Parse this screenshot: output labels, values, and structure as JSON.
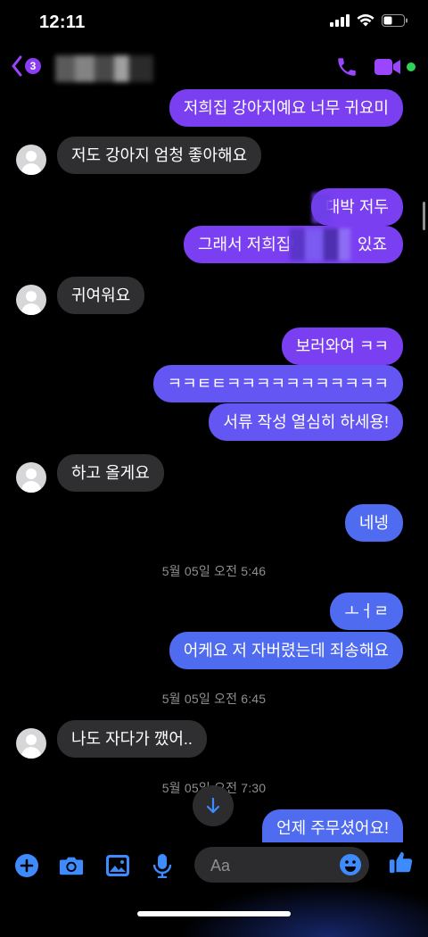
{
  "status_bar": {
    "time": "12:11"
  },
  "header": {
    "unread_count": "3"
  },
  "colors": {
    "purple": "#7b3ff2",
    "blue": "#4f6bf0",
    "incoming": "#2f2f31",
    "accent": "#9b45ff",
    "online": "#31d158"
  },
  "messages": {
    "m1": "저희집 강아지예요 너무 귀요미",
    "m2": "저도 강아지 엄청 좋아해요",
    "m3": "대박 저두",
    "m4": "그래서 저희집에",
    "m4b": "있죠",
    "m5": "귀여워요",
    "m6": "보러와여 ㅋㅋ",
    "m7": "ㅋㅋㅌㅌㅋㅋㅋㅋㅋㅋㅋㅋㅋㅋㅋ",
    "m8": "서류 작성 열심히 하세용!",
    "m9": "하고 올게요",
    "m10": "네넹",
    "ts1": "5월 05일 오전 5:46",
    "m11": "ㅗㅓㄹ",
    "m12": "어케요 저 자버렸는데 죄송해요",
    "ts2": "5월 05일 오전 6:45",
    "m13": "나도 자다가 깼어..",
    "ts3": "5월 05일 오전 7:30",
    "m14": "언제 주무셨어요!"
  },
  "composer": {
    "placeholder": "Aa"
  },
  "icons": [
    "back-chevron-icon",
    "phone-icon",
    "video-icon",
    "plus-icon",
    "camera-icon",
    "image-icon",
    "microphone-icon",
    "emoji-icon",
    "thumbs-up-icon",
    "arrow-down-icon"
  ]
}
